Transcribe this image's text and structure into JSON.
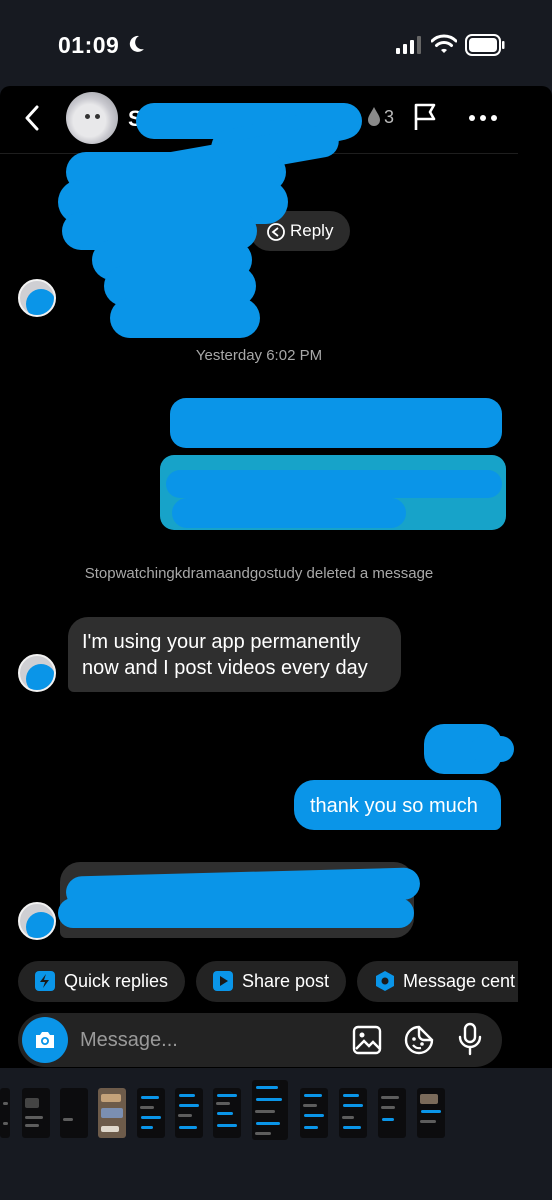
{
  "status_bar": {
    "time": "01:09"
  },
  "header": {
    "name_initial": "S",
    "streak_count": "3"
  },
  "chat": {
    "reply_label": "Reply",
    "timestamp": "Yesterday 6:02 PM",
    "deleted_notice": "Stopwatchingkdramaandgostudy deleted a message",
    "incoming_line_1": "I'm using your app permanently",
    "incoming_line_2": "now and I post videos every day",
    "outgoing_text": "thank you so much"
  },
  "quick_actions": [
    {
      "label": "Quick replies",
      "icon": "lightning-icon"
    },
    {
      "label": "Share post",
      "icon": "play-icon"
    },
    {
      "label": "Message cent",
      "icon": "hexagon-icon"
    }
  ],
  "composer": {
    "placeholder": "Message..."
  },
  "colors": {
    "accent": "#0a95e8",
    "background": "#000000",
    "bubble_incoming": "#2f2f2f",
    "page": "#171a21"
  }
}
